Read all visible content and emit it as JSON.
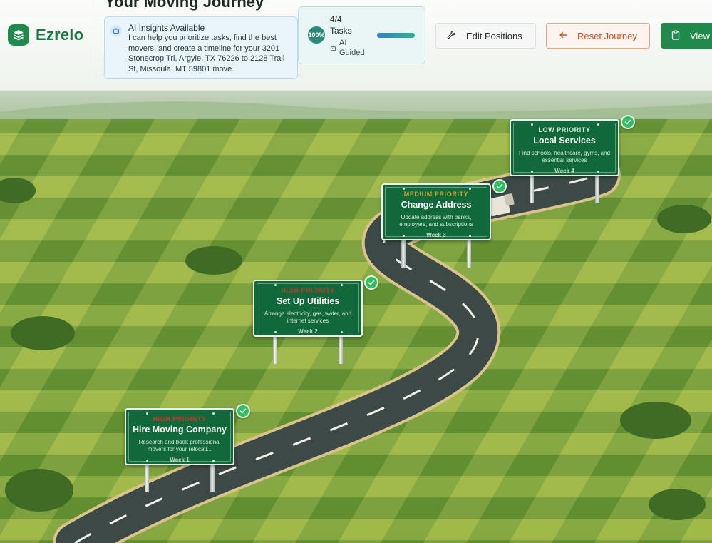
{
  "app": {
    "brand": "Ezrelo",
    "page_title": "Your Moving Journey"
  },
  "ai_insights": {
    "title": "AI Insights Available",
    "message": "I can help you prioritize tasks, find the best movers, and create a timeline for your 3201 Stonecrop Trl, Argyle, TX 76226 to 2128 Trail St, Missoula, MT 59801 move."
  },
  "progress": {
    "percent_label": "100%",
    "count": "4/4",
    "label": "Tasks",
    "ai_guided_line1": "AI",
    "ai_guided_line2": "Guided",
    "fill_fraction": 1.0
  },
  "toolbar": {
    "edit_label": "Edit Positions",
    "reset_label": "Reset Journey",
    "view_label": "View"
  },
  "tasks": [
    {
      "priority": "HIGH PRIORITY",
      "priority_color": "#c0392b",
      "title": "Hire Moving Company",
      "desc": "Research and book professional movers for your relocati...",
      "week": "Week 1",
      "completed": true
    },
    {
      "priority": "HIGH PRIORITY",
      "priority_color": "#c0392b",
      "title": "Set Up Utilities",
      "desc": "Arrange electricity, gas, water, and internet services",
      "week": "Week 2",
      "completed": true
    },
    {
      "priority": "MEDIUM PRIORITY",
      "priority_color": "#d4a22a",
      "title": "Change Address",
      "desc": "Update address with banks, employers, and subscriptions",
      "week": "Week 3",
      "completed": true
    },
    {
      "priority": "LOW PRIORITY",
      "priority_color": "#cfe9d6",
      "title": "Local Services",
      "desc": "Find schools, healthcare, gyms, and essential services",
      "week": "Week 4",
      "completed": true
    }
  ],
  "colors": {
    "brand_green": "#1f8a4c",
    "reset_orange": "#c8542b",
    "sign_green": "#11683a",
    "check_green": "#2fbf62"
  }
}
